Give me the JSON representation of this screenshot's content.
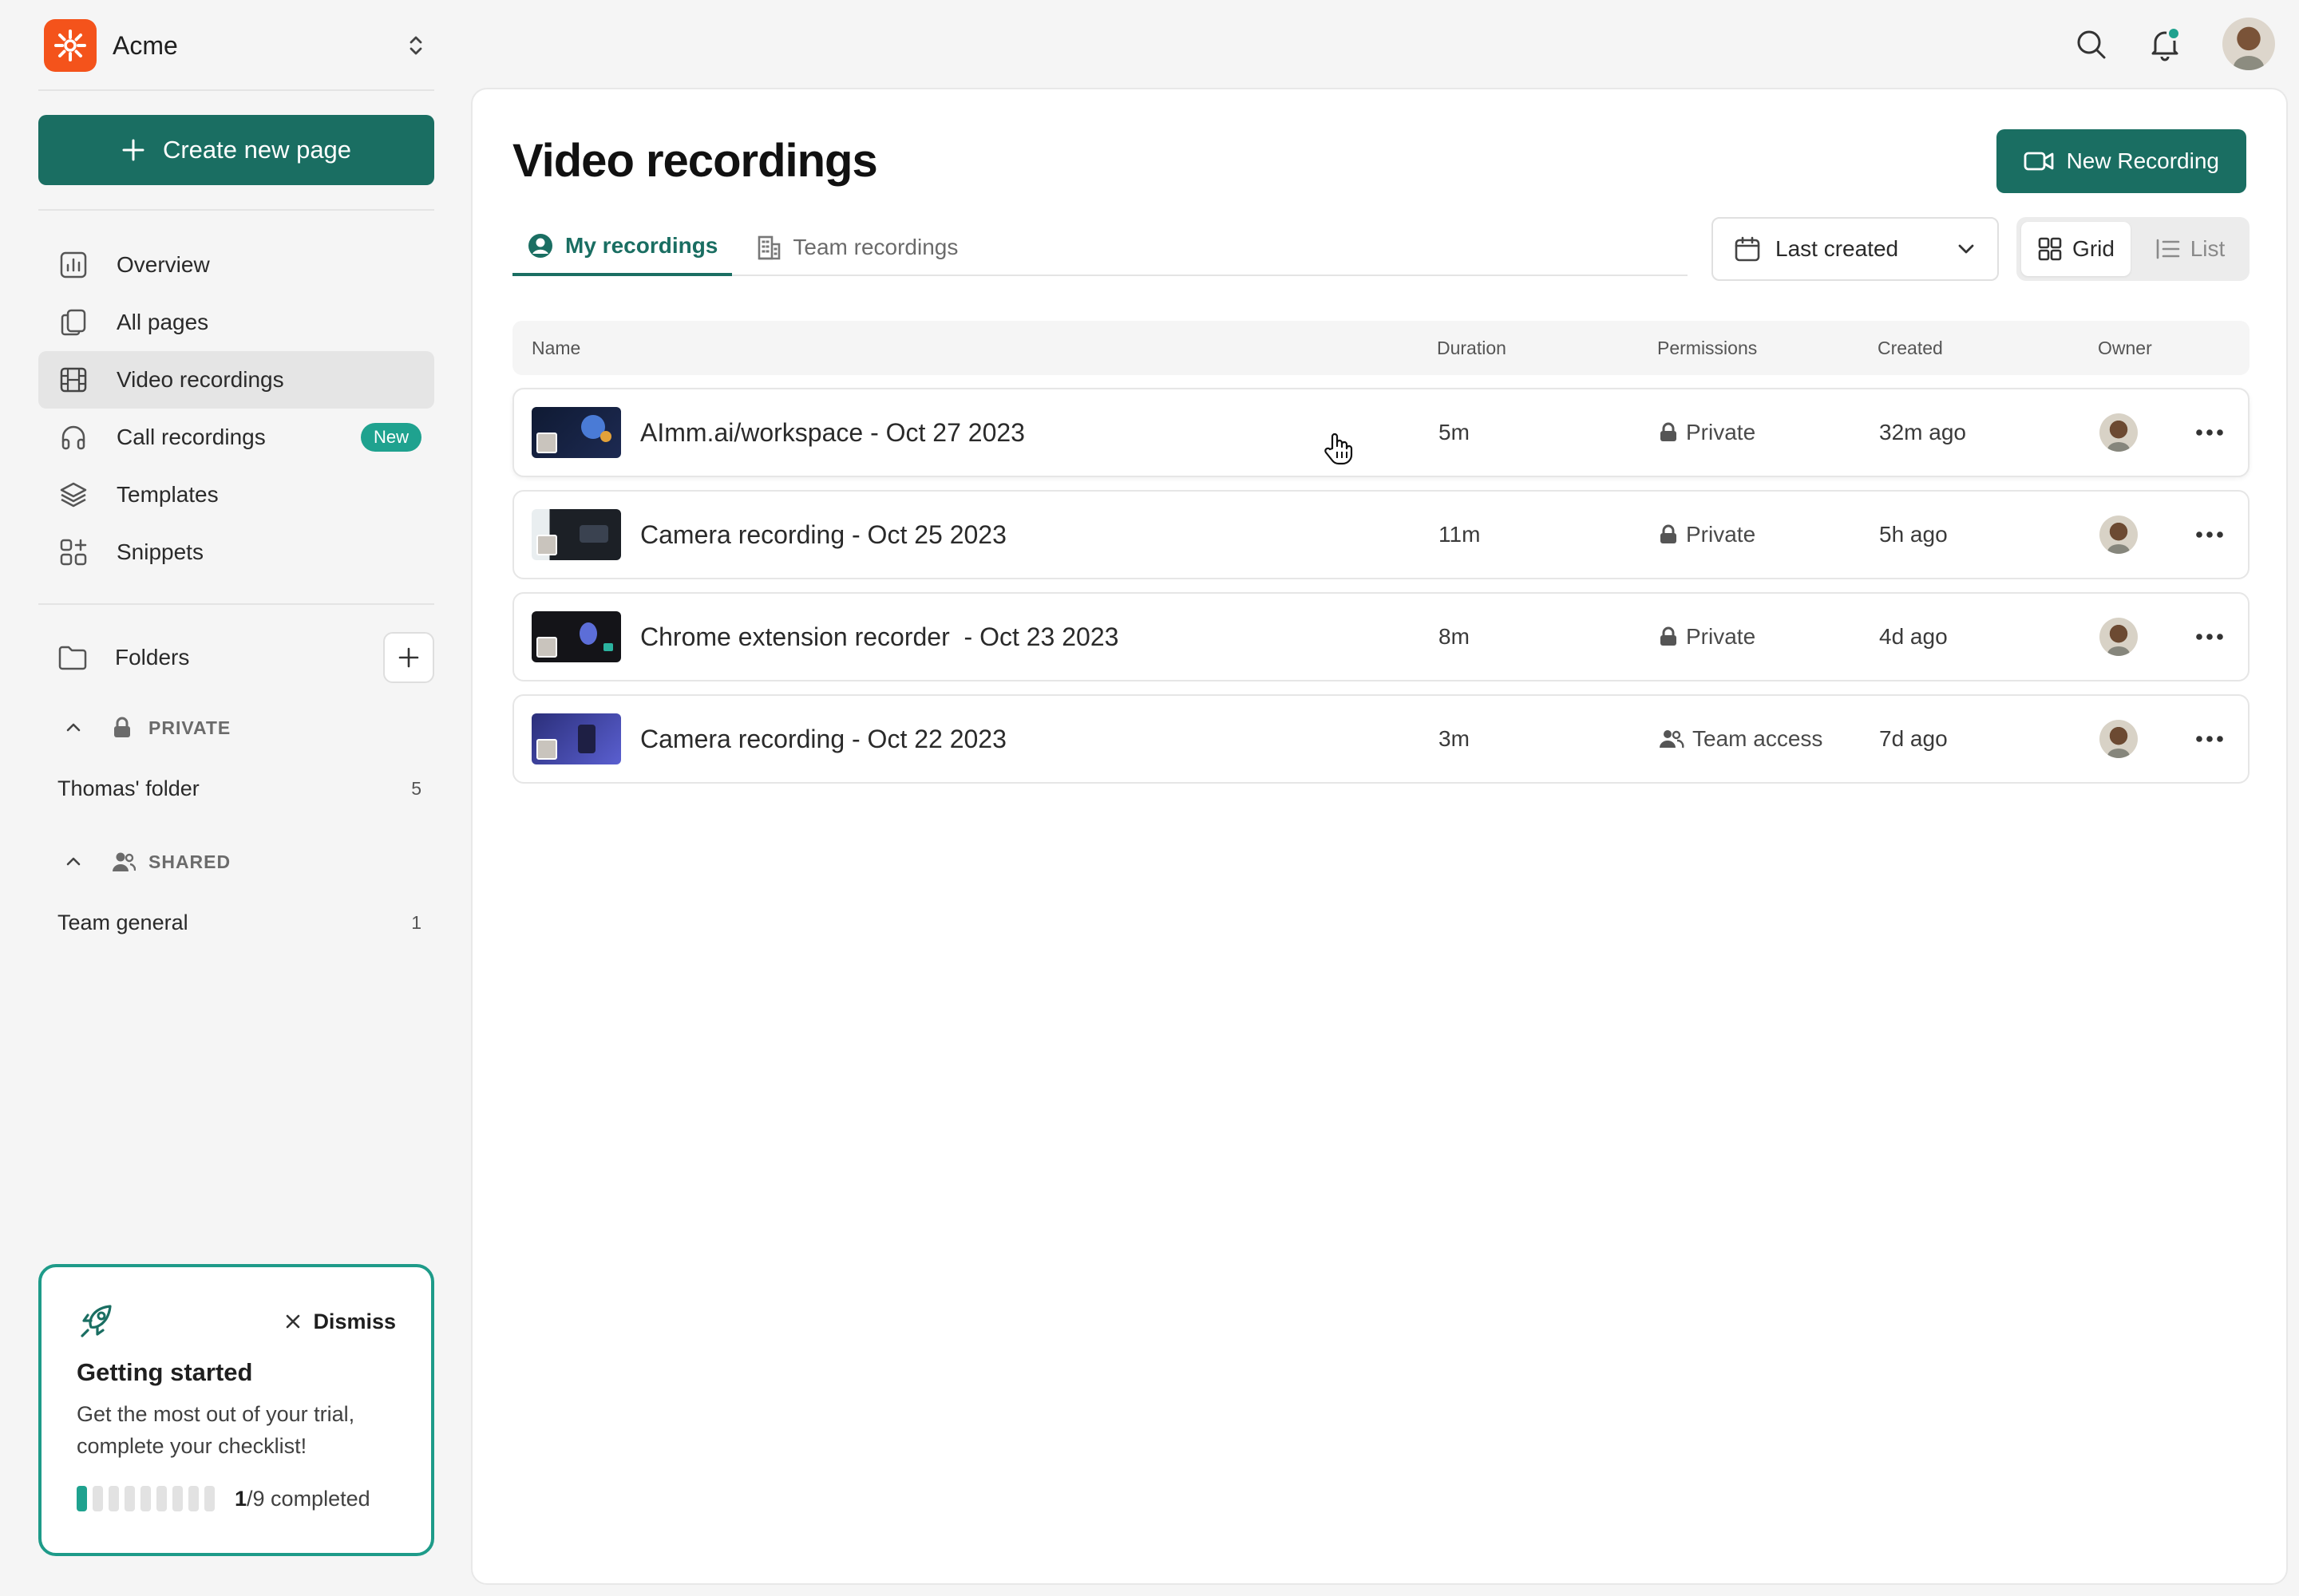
{
  "workspace": {
    "name": "Acme"
  },
  "sidebar": {
    "create_label": "Create new page",
    "nav": [
      {
        "label": "Overview",
        "icon": "chart-icon"
      },
      {
        "label": "All pages",
        "icon": "pages-icon"
      },
      {
        "label": "Video recordings",
        "icon": "film-icon",
        "active": true
      },
      {
        "label": "Call recordings",
        "icon": "headphones-icon",
        "badge": "New"
      },
      {
        "label": "Templates",
        "icon": "layers-icon"
      },
      {
        "label": "Snippets",
        "icon": "snippets-icon"
      }
    ],
    "folders_label": "Folders",
    "private": {
      "label": "PRIVATE",
      "items": [
        {
          "name": "Thomas' folder",
          "count": "5"
        }
      ]
    },
    "shared": {
      "label": "SHARED",
      "items": [
        {
          "name": "Team general",
          "count": "1"
        }
      ]
    },
    "getting_started": {
      "dismiss": "Dismiss",
      "title": "Getting started",
      "desc": "Get the most out of your trial, complete your checklist!",
      "done": "1",
      "total_label": "/9 completed",
      "progress_done": 1,
      "progress_total": 9
    }
  },
  "main": {
    "title": "Video recordings",
    "new_recording": "New Recording",
    "tabs": [
      {
        "label": "My recordings"
      },
      {
        "label": "Team recordings"
      }
    ],
    "sort": "Last created",
    "view": {
      "grid": "Grid",
      "list": "List"
    },
    "columns": {
      "name": "Name",
      "duration": "Duration",
      "permissions": "Permissions",
      "created": "Created",
      "owner": "Owner"
    },
    "rows": [
      {
        "name": "AImm.ai/workspace - Oct 27 2023",
        "duration": "5m",
        "permission": "Private",
        "created": "32m ago"
      },
      {
        "name": "Camera recording - Oct 25 2023",
        "duration": "11m",
        "permission": "Private",
        "created": "5h ago"
      },
      {
        "name": "Chrome extension recorder  - Oct 23 2023",
        "duration": "8m",
        "permission": "Private",
        "created": "4d ago"
      },
      {
        "name": "Camera recording - Oct 22 2023",
        "duration": "3m",
        "permission": "Team access",
        "created": "7d ago"
      }
    ]
  },
  "colors": {
    "accent": "#1a6e62",
    "accent_light": "#1fa28f",
    "brand": "#f4531b"
  }
}
